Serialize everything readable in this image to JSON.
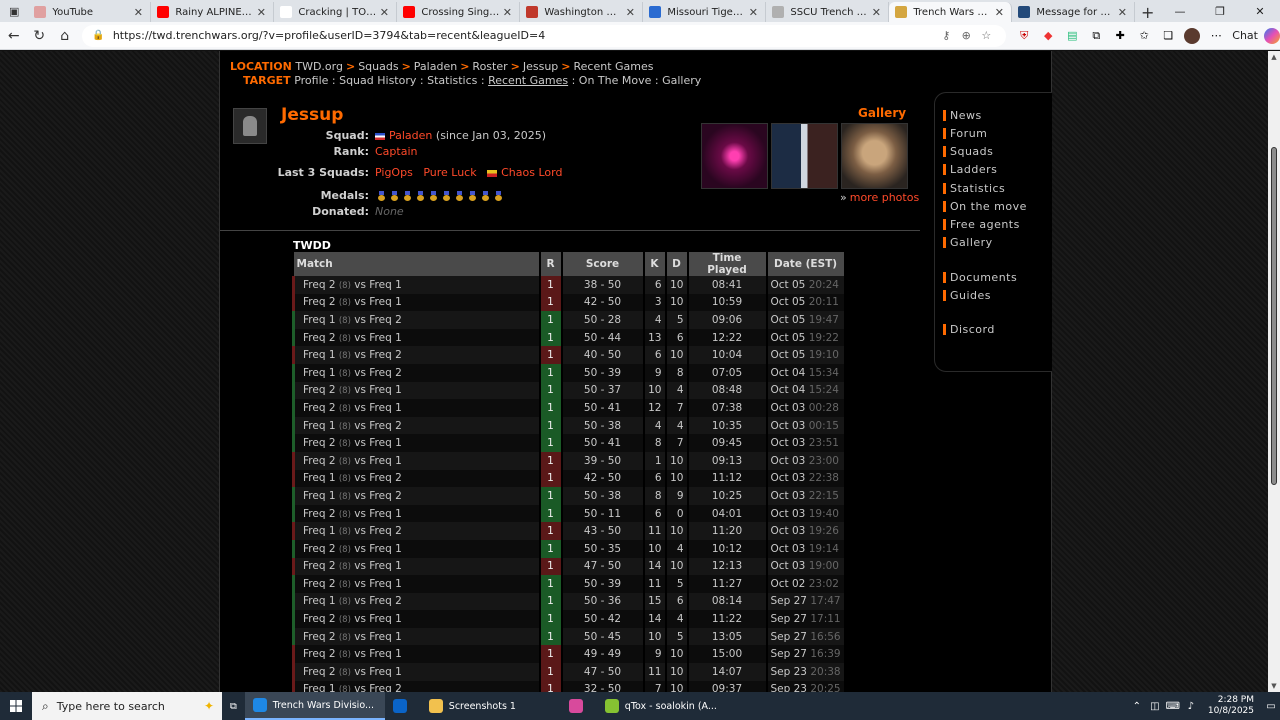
{
  "browser": {
    "tabs": [
      {
        "title": "YouTube",
        "color": "#e0a0a0"
      },
      {
        "title": "Rainy ALPINE LAKE Fis",
        "color": "#ff0000"
      },
      {
        "title": "Cracking | TORN",
        "color": "#ffffff"
      },
      {
        "title": "Crossing Singapore Str",
        "color": "#ff0000"
      },
      {
        "title": "Washington Command",
        "color": "#c0382b"
      },
      {
        "title": "Missouri Tigers Basket",
        "color": "#2a6bd1"
      },
      {
        "title": "SSCU Trench Wars - Th",
        "color": "#b0b0b0"
      },
      {
        "title": "Trench Wars Divisions",
        "color": "#d4a640"
      },
      {
        "title": "Message for Qan - SSC",
        "color": "#234a7a"
      }
    ],
    "active_tab": 7,
    "url": "https://twd.trenchwars.org/?v=profile&userID=3794&tab=recent&leagueID=4",
    "chat_label": "Chat"
  },
  "breadcrumb": {
    "location_label": "LOCATION",
    "location_path": [
      "TWD.org",
      "Squads",
      "Paladen",
      "Roster",
      "Jessup",
      "Recent Games"
    ],
    "target_label": "TARGET",
    "target_links": [
      "Profile",
      "Squad History",
      "Statistics",
      "Recent Games",
      "On The Move",
      "Gallery"
    ],
    "active_target": "Recent Games"
  },
  "profile": {
    "name": "Jessup",
    "squad_label": "Squad:",
    "squad_name": "Paladen",
    "squad_since": "(since Jan 03, 2025)",
    "rank_label": "Rank:",
    "rank": "Captain",
    "last3_label": "Last 3 Squads:",
    "last3": [
      "PigOps",
      "Pure Luck",
      "Chaos Lord"
    ],
    "medals_label": "Medals:",
    "medal_count": 10,
    "donated_label": "Donated:",
    "donated": "None"
  },
  "gallery": {
    "title": "Gallery",
    "more_link": "more photos"
  },
  "sidebar": {
    "items": [
      "News",
      "Forum",
      "Squads",
      "Ladders",
      "Statistics",
      "On the move",
      "Free agents",
      "Gallery",
      "Documents",
      "Guides",
      "Discord"
    ]
  },
  "table": {
    "section_title": "TWDD",
    "headers": {
      "match": "Match",
      "r": "R",
      "score": "Score",
      "k": "K",
      "d": "D",
      "time": "Time Played",
      "date": "Date",
      "tz": "(EST)"
    },
    "size_tag": "(8)",
    "vs": "vs",
    "rows": [
      {
        "f1": "Freq 2",
        "f2": "Freq 1",
        "r": "1",
        "result": "loss",
        "score": "38 - 50",
        "k": "6",
        "d": "10",
        "tp": "08:41",
        "date": "Oct 05",
        "time": "20:24"
      },
      {
        "f1": "Freq 2",
        "f2": "Freq 1",
        "r": "1",
        "result": "loss",
        "score": "42 - 50",
        "k": "3",
        "d": "10",
        "tp": "10:59",
        "date": "Oct 05",
        "time": "20:11"
      },
      {
        "f1": "Freq 1",
        "f2": "Freq 2",
        "r": "1",
        "result": "win",
        "score": "50 - 28",
        "k": "4",
        "d": "5",
        "tp": "09:06",
        "date": "Oct 05",
        "time": "19:47"
      },
      {
        "f1": "Freq 2",
        "f2": "Freq 1",
        "r": "1",
        "result": "win",
        "score": "50 - 44",
        "k": "13",
        "d": "6",
        "tp": "12:22",
        "date": "Oct 05",
        "time": "19:22"
      },
      {
        "f1": "Freq 1",
        "f2": "Freq 2",
        "r": "1",
        "result": "loss",
        "score": "40 - 50",
        "k": "6",
        "d": "10",
        "tp": "10:04",
        "date": "Oct 05",
        "time": "19:10"
      },
      {
        "f1": "Freq 1",
        "f2": "Freq 2",
        "r": "1",
        "result": "win",
        "score": "50 - 39",
        "k": "9",
        "d": "8",
        "tp": "07:05",
        "date": "Oct 04",
        "time": "15:34"
      },
      {
        "f1": "Freq 2",
        "f2": "Freq 1",
        "r": "1",
        "result": "win",
        "score": "50 - 37",
        "k": "10",
        "d": "4",
        "tp": "08:48",
        "date": "Oct 04",
        "time": "15:24"
      },
      {
        "f1": "Freq 2",
        "f2": "Freq 1",
        "r": "1",
        "result": "win",
        "score": "50 - 41",
        "k": "12",
        "d": "7",
        "tp": "07:38",
        "date": "Oct 03",
        "time": "00:28"
      },
      {
        "f1": "Freq 1",
        "f2": "Freq 2",
        "r": "1",
        "result": "win",
        "score": "50 - 38",
        "k": "4",
        "d": "4",
        "tp": "10:35",
        "date": "Oct 03",
        "time": "00:15"
      },
      {
        "f1": "Freq 2",
        "f2": "Freq 1",
        "r": "1",
        "result": "win",
        "score": "50 - 41",
        "k": "8",
        "d": "7",
        "tp": "09:45",
        "date": "Oct 03",
        "time": "23:51"
      },
      {
        "f1": "Freq 2",
        "f2": "Freq 1",
        "r": "1",
        "result": "loss",
        "score": "39 - 50",
        "k": "1",
        "d": "10",
        "tp": "09:13",
        "date": "Oct 03",
        "time": "23:00"
      },
      {
        "f1": "Freq 1",
        "f2": "Freq 2",
        "r": "1",
        "result": "loss",
        "score": "42 - 50",
        "k": "6",
        "d": "10",
        "tp": "11:12",
        "date": "Oct 03",
        "time": "22:38"
      },
      {
        "f1": "Freq 1",
        "f2": "Freq 2",
        "r": "1",
        "result": "win",
        "score": "50 - 38",
        "k": "8",
        "d": "9",
        "tp": "10:25",
        "date": "Oct 03",
        "time": "22:15"
      },
      {
        "f1": "Freq 2",
        "f2": "Freq 1",
        "r": "1",
        "result": "win",
        "score": "50 - 11",
        "k": "6",
        "d": "0",
        "tp": "04:01",
        "date": "Oct 03",
        "time": "19:40"
      },
      {
        "f1": "Freq 1",
        "f2": "Freq 2",
        "r": "1",
        "result": "loss",
        "score": "43 - 50",
        "k": "11",
        "d": "10",
        "tp": "11:20",
        "date": "Oct 03",
        "time": "19:26"
      },
      {
        "f1": "Freq 2",
        "f2": "Freq 1",
        "r": "1",
        "result": "win",
        "score": "50 - 35",
        "k": "10",
        "d": "4",
        "tp": "10:12",
        "date": "Oct 03",
        "time": "19:14"
      },
      {
        "f1": "Freq 2",
        "f2": "Freq 1",
        "r": "1",
        "result": "loss",
        "score": "47 - 50",
        "k": "14",
        "d": "10",
        "tp": "12:13",
        "date": "Oct 03",
        "time": "19:00"
      },
      {
        "f1": "Freq 2",
        "f2": "Freq 1",
        "r": "1",
        "result": "win",
        "score": "50 - 39",
        "k": "11",
        "d": "5",
        "tp": "11:27",
        "date": "Oct 02",
        "time": "23:02"
      },
      {
        "f1": "Freq 1",
        "f2": "Freq 2",
        "r": "1",
        "result": "win",
        "score": "50 - 36",
        "k": "15",
        "d": "6",
        "tp": "08:14",
        "date": "Sep 27",
        "time": "17:47"
      },
      {
        "f1": "Freq 2",
        "f2": "Freq 1",
        "r": "1",
        "result": "win",
        "score": "50 - 42",
        "k": "14",
        "d": "4",
        "tp": "11:22",
        "date": "Sep 27",
        "time": "17:11"
      },
      {
        "f1": "Freq 2",
        "f2": "Freq 1",
        "r": "1",
        "result": "win",
        "score": "50 - 45",
        "k": "10",
        "d": "5",
        "tp": "13:05",
        "date": "Sep 27",
        "time": "16:56"
      },
      {
        "f1": "Freq 2",
        "f2": "Freq 1",
        "r": "1",
        "result": "loss",
        "score": "49 - 49",
        "k": "9",
        "d": "10",
        "tp": "15:00",
        "date": "Sep 27",
        "time": "16:39"
      },
      {
        "f1": "Freq 2",
        "f2": "Freq 1",
        "r": "1",
        "result": "loss",
        "score": "47 - 50",
        "k": "11",
        "d": "10",
        "tp": "14:07",
        "date": "Sep 23",
        "time": "20:38"
      },
      {
        "f1": "Freq 1",
        "f2": "Freq 2",
        "r": "1",
        "result": "loss",
        "score": "32 - 50",
        "k": "7",
        "d": "10",
        "tp": "09:37",
        "date": "Sep 23",
        "time": "20:25"
      }
    ]
  },
  "taskbar": {
    "search_placeholder": "Type here to search",
    "items": [
      {
        "label": "Trench Wars Divisio...",
        "color": "#1e88e5",
        "active": true
      },
      {
        "label": "",
        "color": "#0a64c8",
        "active": false
      },
      {
        "label": "Screenshots 1",
        "color": "#f2c14e",
        "active": false
      },
      {
        "label": "",
        "color": "#d84a9c",
        "active": false
      },
      {
        "label": "qTox - soalokin (A...",
        "color": "#86c232",
        "active": false
      }
    ],
    "time": "2:28 PM",
    "date": "10/8/2025"
  },
  "colors": {
    "accent": "#ff6a00",
    "link": "#ff4a2a",
    "win": "#1a5a26",
    "loss": "#5a1818"
  }
}
